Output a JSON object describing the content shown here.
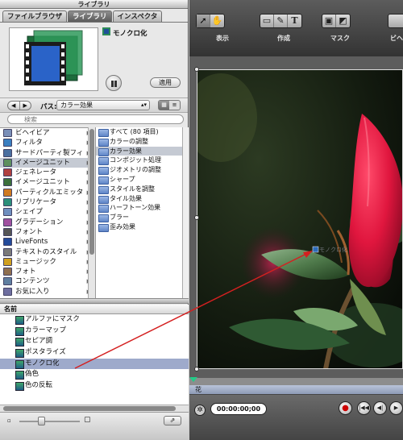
{
  "library": {
    "title": "ライブラリ",
    "tabs": [
      {
        "label": "ファイルブラウザ",
        "active": false
      },
      {
        "label": "ライブラリ",
        "active": true
      },
      {
        "label": "インスペクタ",
        "active": false
      }
    ],
    "preview_item": "モノクロ化",
    "apply_label": "適用",
    "path_label": "パス:",
    "path_value": "カラー効果",
    "search_placeholder": "検索",
    "categories": [
      {
        "label": "ビヘイビア",
        "color": "#7a8fb8"
      },
      {
        "label": "フィルタ",
        "color": "#3a7fc0"
      },
      {
        "label": "サードパーティ製フィ",
        "color": "#4a6fa0"
      },
      {
        "label": "イメージユニット",
        "color": "#5d8f5d",
        "selected": true
      },
      {
        "label": "ジェネレータ",
        "color": "#b04040"
      },
      {
        "label": "イメージユニット",
        "color": "#3b6f3b"
      },
      {
        "label": "パーティクルエミッタ",
        "color": "#d07a20"
      },
      {
        "label": "リプリケータ",
        "color": "#2b8f7a"
      },
      {
        "label": "シェイプ",
        "color": "#6f8fbf"
      },
      {
        "label": "グラデーション",
        "color": "#a050a0"
      },
      {
        "label": "フォント",
        "color": "#555"
      },
      {
        "label": "LiveFonts",
        "color": "#234a9a"
      },
      {
        "label": "テキストのスタイル",
        "color": "#7a7a7a"
      },
      {
        "label": "ミュージック",
        "color": "#d0a020"
      },
      {
        "label": "フォト",
        "color": "#8f6f4f"
      },
      {
        "label": "コンテンツ",
        "color": "#5f7fa0"
      },
      {
        "label": "お気に入り",
        "color": "#6f6fa0"
      }
    ],
    "subcategories": [
      {
        "label": "すべて (80 項目)"
      },
      {
        "label": "カラーの調整"
      },
      {
        "label": "カラー効果",
        "selected": true
      },
      {
        "label": "コンポジット処理"
      },
      {
        "label": "ジオメトリの調整"
      },
      {
        "label": "シャープ"
      },
      {
        "label": "スタイルを調整"
      },
      {
        "label": "タイル効果"
      },
      {
        "label": "ハーフトーン効果"
      },
      {
        "label": "ブラー"
      },
      {
        "label": "歪み効果"
      }
    ],
    "list_header": "名前",
    "items": [
      {
        "label": "アルファにマスク"
      },
      {
        "label": "カラーマップ"
      },
      {
        "label": "セピア調"
      },
      {
        "label": "ポスタライズ"
      },
      {
        "label": "モノクロ化",
        "selected": true
      },
      {
        "label": "偽色"
      },
      {
        "label": "色の反転"
      }
    ]
  },
  "toolbar": {
    "groups": [
      {
        "label": "表示",
        "icons": [
          "arrow-select",
          "pan-hand"
        ]
      },
      {
        "label": "作成",
        "icons": [
          "rectangle-shape",
          "bezier-pen",
          "text-tool"
        ]
      },
      {
        "label": "マスク",
        "icons": [
          "rect-mask",
          "bezier-mask"
        ]
      },
      {
        "label": "ビヘ",
        "icons": []
      }
    ]
  },
  "canvas": {
    "drag_label": "モノクロ化"
  },
  "timeline": {
    "track_label": "花",
    "timecode": "00:00:00;00"
  },
  "colors": {
    "selection": "#c5cad3",
    "list_selection": "#9eaacb",
    "arrow": "#d42020"
  }
}
